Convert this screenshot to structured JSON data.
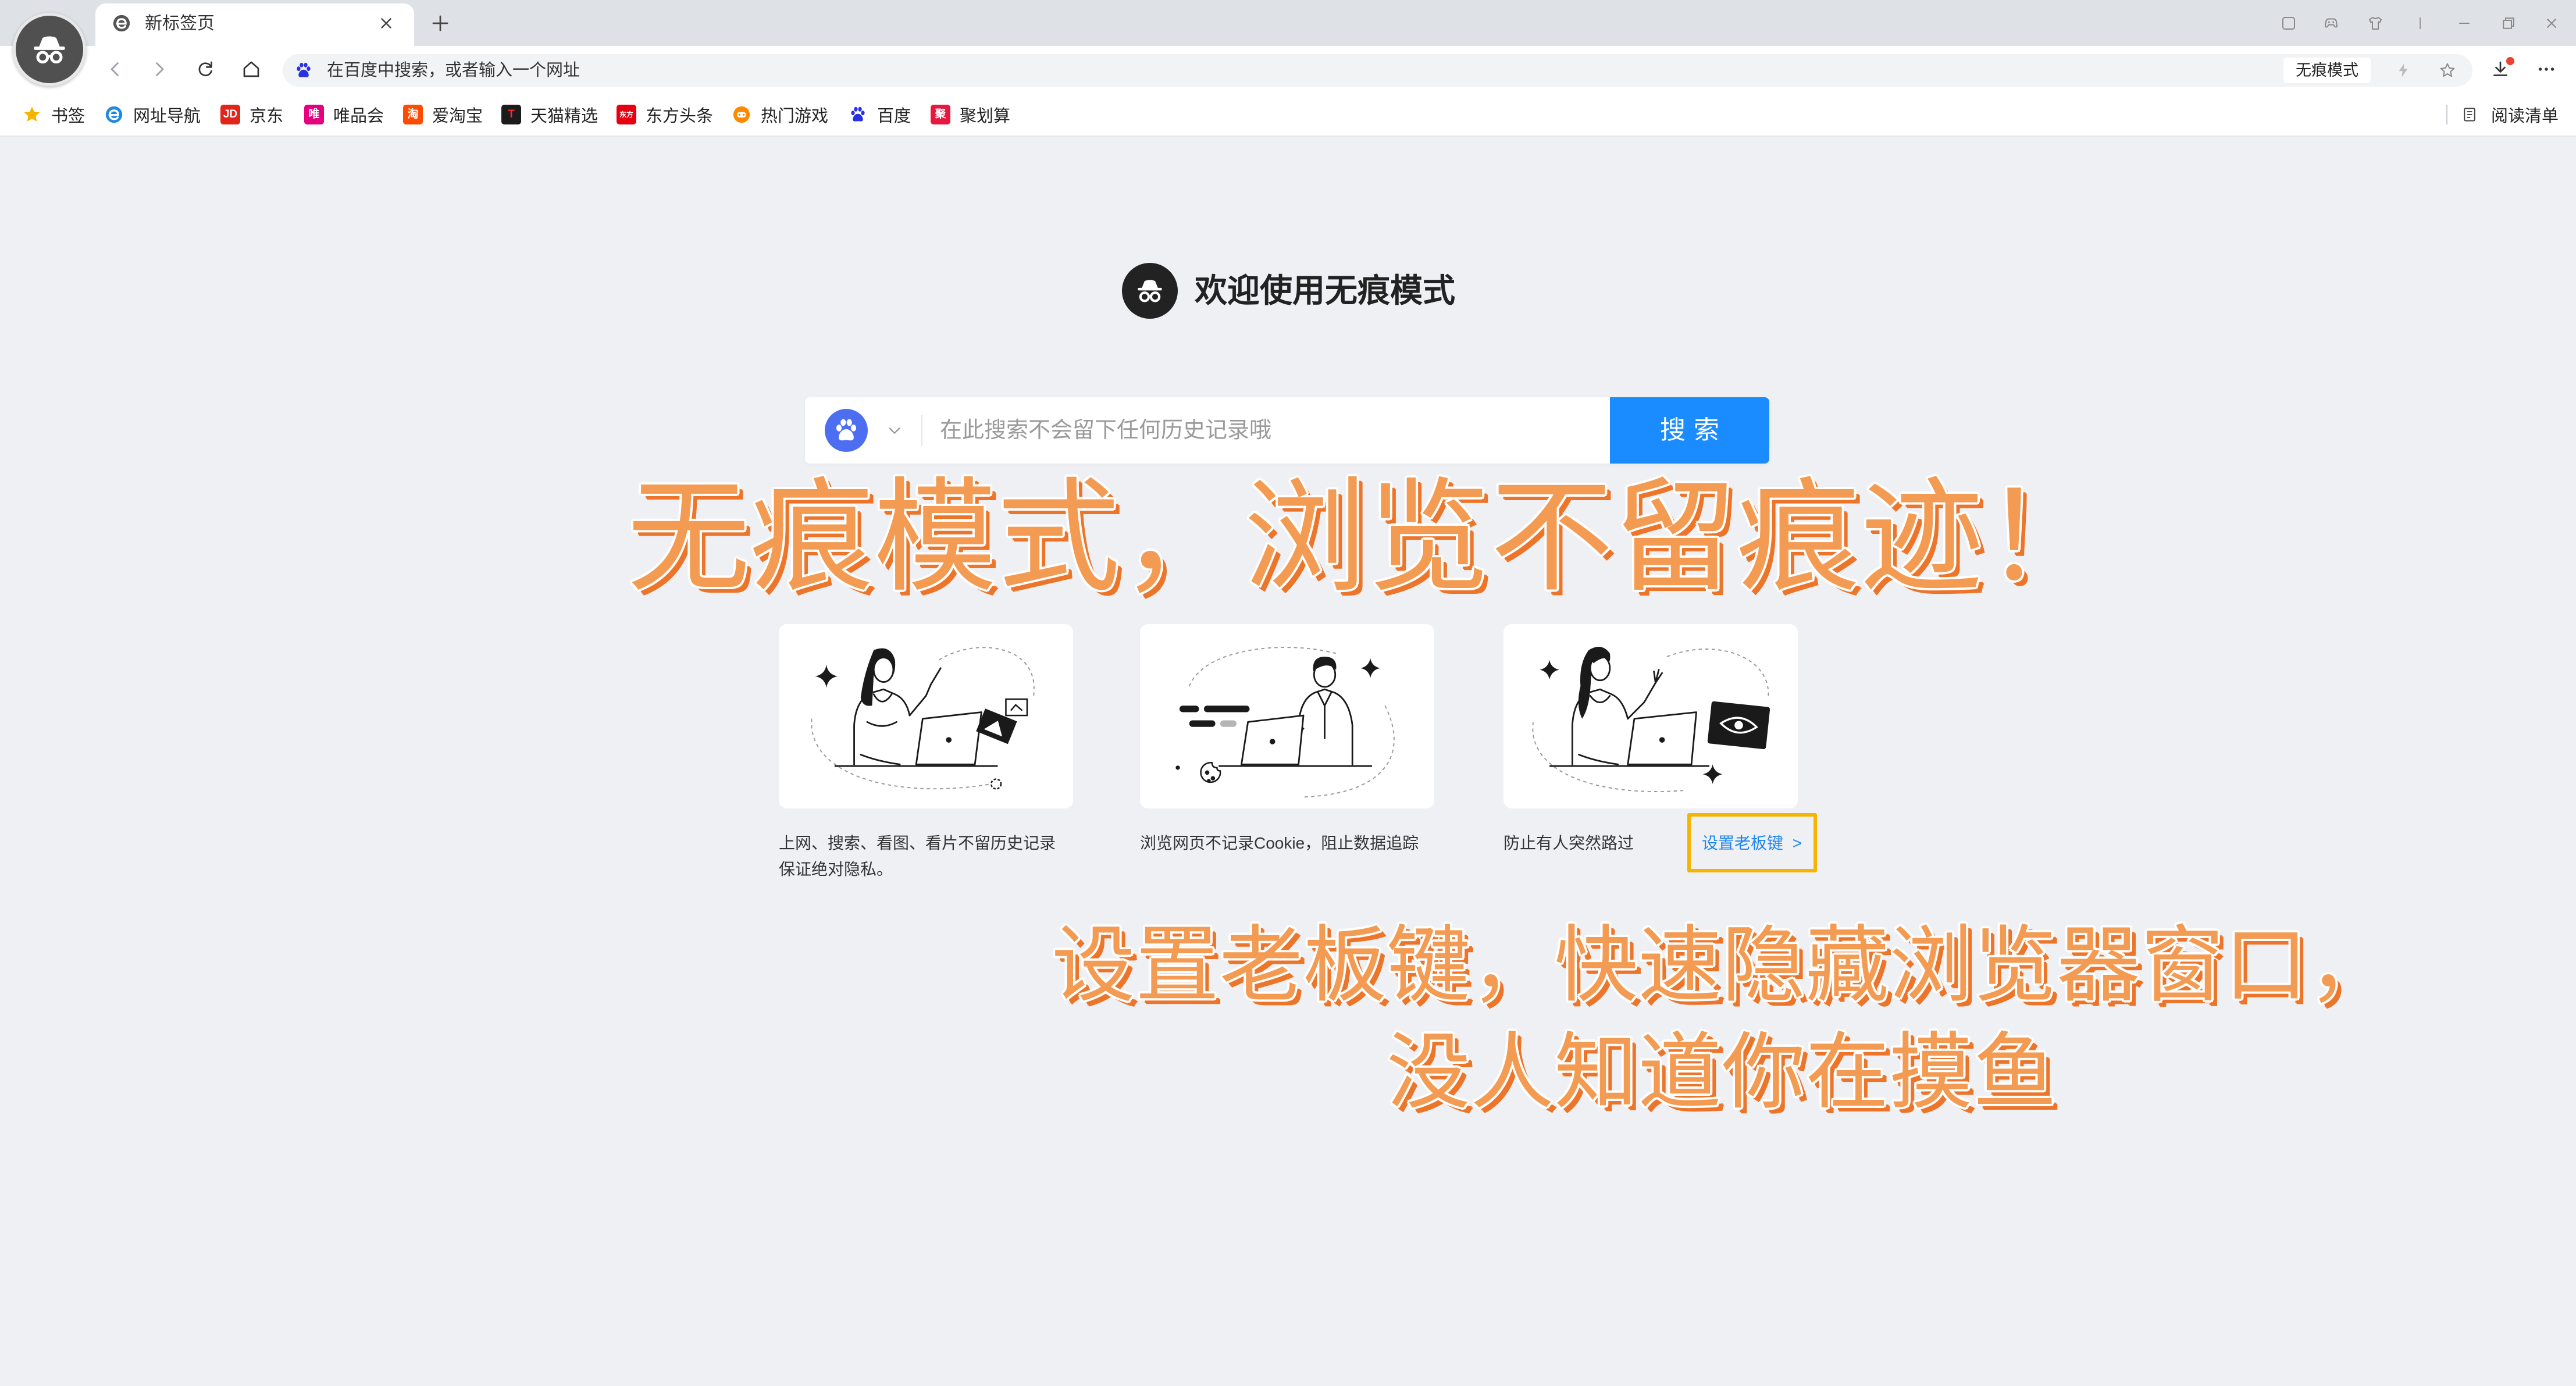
{
  "browser": {
    "tab_title": "新标签页",
    "incognito_badge": "无痕模式",
    "address_placeholder": "在百度中搜索，或者输入一个网址",
    "icons": [
      "incognito-avatar-icon",
      "browser-logo-icon",
      "close-icon",
      "plus-icon",
      "sidebar-icon",
      "gamepad-icon",
      "skin-icon",
      "minimize-icon",
      "restore-icon",
      "window-close-icon",
      "back-icon",
      "forward-icon",
      "reload-icon",
      "home-icon",
      "baidu-paw-icon",
      "lightning-icon",
      "star-icon",
      "download-icon",
      "more-icon"
    ]
  },
  "bookmarks": {
    "items": [
      {
        "label": "书签",
        "icon": "star-icon",
        "color": "#f5b400"
      },
      {
        "label": "网址导航",
        "icon": "nav-e-icon",
        "color": "#1e88e5"
      },
      {
        "label": "京东",
        "icon_text": "JD",
        "color": "#e1251b"
      },
      {
        "label": "唯品会",
        "icon_text": "唯",
        "color": "#e4007f"
      },
      {
        "label": "爱淘宝",
        "icon_text": "淘",
        "color": "#ff4a00"
      },
      {
        "label": "天猫精选",
        "icon_text": "T",
        "color": "#1b1b1b"
      },
      {
        "label": "东方头条",
        "icon_text": "东方",
        "color": "#e60012"
      },
      {
        "label": "热门游戏",
        "icon": "game-icon",
        "color": "#ff8a00"
      },
      {
        "label": "百度",
        "icon": "baidu-paw-icon",
        "color": "#2932e1"
      },
      {
        "label": "聚划算",
        "icon_text": "聚",
        "color": "#e8173d"
      }
    ],
    "reading_list": "阅读清单"
  },
  "welcome": {
    "title": "欢迎使用无痕模式",
    "icon": "incognito-icon"
  },
  "search": {
    "placeholder": "在此搜索不会留下任何历史记录哦",
    "button_label": "搜索",
    "engine_icon": "baidu-paw-icon",
    "button_color": "#1a8cff",
    "engine_color": "#4e6ef2"
  },
  "features": [
    {
      "line1": "上网、搜索、看图、看片不留历史记录",
      "line2": "保证绝对隐私。"
    },
    {
      "line1": "浏览网页不记录Cookie，阻止数据追踪"
    },
    {
      "line1": "防止有人突然路过",
      "link_label": "设置老板键",
      "link_arrow": ">"
    }
  ],
  "annotations": {
    "headline": "无痕模式，浏览不留痕迹！",
    "note_line1": "设置老板键，快速隐藏浏览器窗口，",
    "note_line2": "没人知道你在摸鱼",
    "text_color": "#f39b52",
    "highlight_color": "#f6b400"
  },
  "colors": {
    "page_background": "#eef0f4",
    "tab_strip": "#dee1e6",
    "link": "#1f86f0"
  }
}
